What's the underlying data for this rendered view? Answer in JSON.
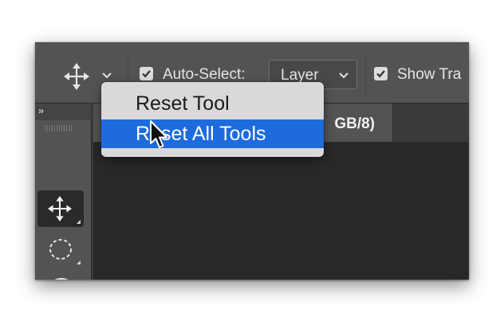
{
  "options_bar": {
    "tool_preset_icon": "move-arrows-icon",
    "tool_preset_chevron_icon": "chevron-down-icon",
    "auto_select_label": "Auto-Select:",
    "auto_select_checked": true,
    "auto_select_target": "Layer",
    "show_transform_label": "Show Tra",
    "show_transform_checked": true
  },
  "panel": {
    "collapse_glyph": "››"
  },
  "document_tab": {
    "title": "GB/8)"
  },
  "toolbar": {
    "tools": [
      {
        "name": "move-tool",
        "icon": "move-arrows-icon",
        "active": true
      },
      {
        "name": "marquee-tool",
        "icon": "elliptical-marquee-icon",
        "active": false
      },
      {
        "name": "lasso-tool",
        "icon": "lasso-icon",
        "active": false
      }
    ]
  },
  "context_menu": {
    "items": [
      {
        "label": "Reset Tool",
        "highlighted": false
      },
      {
        "label": "Reset All Tools",
        "highlighted": true
      }
    ]
  },
  "colors": {
    "options_bar_bg": "#535353",
    "canvas_bg": "#282828",
    "menu_bg": "#d9d9d9",
    "highlight": "#1d6bdc"
  }
}
